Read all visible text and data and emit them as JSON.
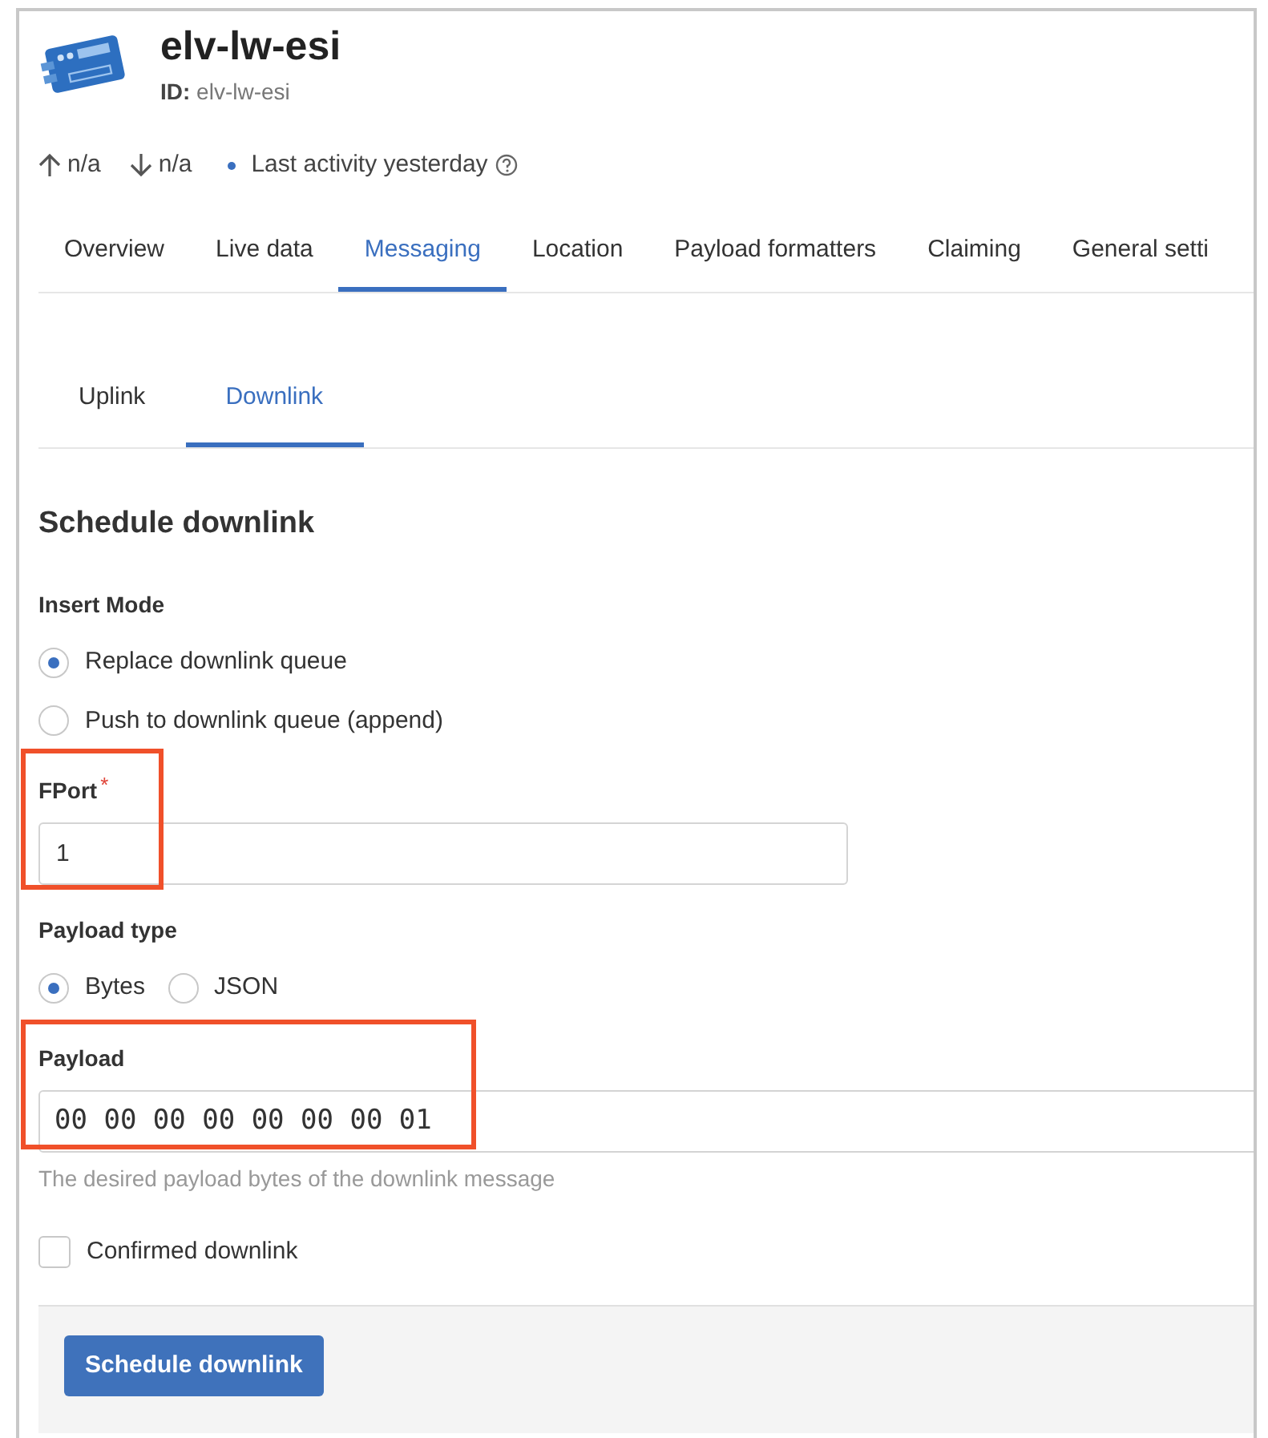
{
  "device": {
    "name": "elv-lw-esi",
    "id_label": "ID:",
    "id_value": "elv-lw-esi"
  },
  "stats": {
    "uplink": "n/a",
    "downlink": "n/a",
    "activity": "Last activity yesterday"
  },
  "tabs": [
    {
      "label": "Overview",
      "selected": false
    },
    {
      "label": "Live data",
      "selected": false
    },
    {
      "label": "Messaging",
      "selected": true
    },
    {
      "label": "Location",
      "selected": false
    },
    {
      "label": "Payload formatters",
      "selected": false
    },
    {
      "label": "Claiming",
      "selected": false
    },
    {
      "label": "General setti",
      "selected": false
    }
  ],
  "subtabs": [
    {
      "label": "Uplink",
      "selected": false
    },
    {
      "label": "Downlink",
      "selected": true
    }
  ],
  "form": {
    "title": "Schedule downlink",
    "insert_mode": {
      "label": "Insert Mode",
      "options": [
        {
          "label": "Replace downlink queue",
          "selected": true
        },
        {
          "label": "Push to downlink queue (append)",
          "selected": false
        }
      ]
    },
    "fport": {
      "label": "FPort",
      "required_mark": "*",
      "value": "1",
      "highlighted": true
    },
    "payload_type": {
      "label": "Payload type",
      "options": [
        {
          "label": "Bytes",
          "selected": true
        },
        {
          "label": "JSON",
          "selected": false
        }
      ]
    },
    "payload": {
      "label": "Payload",
      "value": "00 00 00 00 00 00 00 01",
      "description": "The desired payload bytes of the downlink message",
      "highlighted": true
    },
    "confirmed": {
      "label": "Confirmed downlink",
      "checked": false
    },
    "submit": "Schedule downlink"
  }
}
